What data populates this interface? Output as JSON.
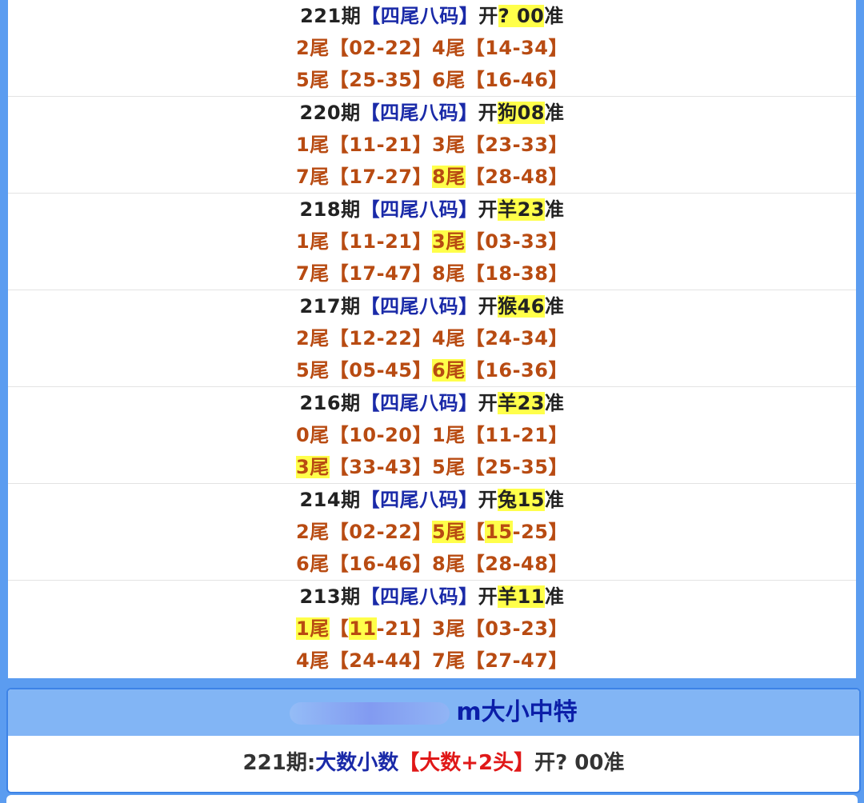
{
  "periods": [
    {
      "period": "221期",
      "tag": "【四尾八码】",
      "open_prefix": "开",
      "open_result": "? 00",
      "open_suffix": "准",
      "row1": [
        {
          "tail": "2尾",
          "nums": "【02-22】"
        },
        {
          "tail": "4尾",
          "nums": "【14-34】"
        }
      ],
      "row2": [
        {
          "tail": "5尾",
          "nums": "【25-35】"
        },
        {
          "tail": "6尾",
          "nums": "【16-46】"
        }
      ]
    },
    {
      "period": "220期",
      "tag": "【四尾八码】",
      "open_prefix": "开",
      "open_result": "狗08",
      "open_suffix": "准",
      "row1": [
        {
          "tail": "1尾",
          "nums": "【11-21】"
        },
        {
          "tail": "3尾",
          "nums": "【23-33】"
        }
      ],
      "row2": [
        {
          "tail": "7尾",
          "nums": "【17-27】"
        },
        {
          "tail": "8尾",
          "nums": "【28-48】"
        }
      ]
    },
    {
      "period": "218期",
      "tag": "【四尾八码】",
      "open_prefix": "开",
      "open_result": "羊23",
      "open_suffix": "准",
      "row1": [
        {
          "tail": "1尾",
          "nums": "【11-21】"
        },
        {
          "tail": "3尾",
          "nums": "【03-33】"
        }
      ],
      "row2": [
        {
          "tail": "7尾",
          "nums": "【17-47】"
        },
        {
          "tail": "8尾",
          "nums": "【18-38】"
        }
      ]
    },
    {
      "period": "217期",
      "tag": "【四尾八码】",
      "open_prefix": "开",
      "open_result": "猴46",
      "open_suffix": "准",
      "row1": [
        {
          "tail": "2尾",
          "nums": "【12-22】"
        },
        {
          "tail": "4尾",
          "nums": "【24-34】"
        }
      ],
      "row2": [
        {
          "tail": "5尾",
          "nums": "【05-45】"
        },
        {
          "tail": "6尾",
          "nums": "【16-36】"
        }
      ]
    },
    {
      "period": "216期",
      "tag": "【四尾八码】",
      "open_prefix": "开",
      "open_result": "羊23",
      "open_suffix": "准",
      "row1": [
        {
          "tail": "0尾",
          "nums": "【10-20】"
        },
        {
          "tail": "1尾",
          "nums": "【11-21】"
        }
      ],
      "row2": [
        {
          "tail": "3尾",
          "nums": "【33-43】"
        },
        {
          "tail": "5尾",
          "nums": "【25-35】"
        }
      ]
    },
    {
      "period": "214期",
      "tag": "【四尾八码】",
      "open_prefix": "开",
      "open_result": "兔15",
      "open_suffix": "准",
      "row1": [
        {
          "tail": "2尾",
          "nums": "【02-22】"
        },
        {
          "tail": "5尾",
          "nums_a": "【",
          "nums_hl": "15",
          "nums_b": "-25】"
        }
      ],
      "row2": [
        {
          "tail": "6尾",
          "nums": "【16-46】"
        },
        {
          "tail": "8尾",
          "nums": "【28-48】"
        }
      ]
    },
    {
      "period": "213期",
      "tag": "【四尾八码】",
      "open_prefix": "开",
      "open_result": "羊11",
      "open_suffix": "准",
      "row1": [
        {
          "tail": "1尾",
          "nums_a": "【",
          "nums_hl": "11",
          "nums_b": "-21】"
        },
        {
          "tail": "3尾",
          "nums": "【03-23】"
        }
      ],
      "row2": [
        {
          "tail": "4尾",
          "nums": "【24-44】"
        },
        {
          "tail": "7尾",
          "nums": "【27-47】"
        }
      ]
    }
  ],
  "section2": {
    "title": "m大小中特",
    "line": {
      "period": "221期:",
      "tag": "大数小数",
      "red": "【大数+2头】",
      "open": "开?",
      "result": " 00准"
    }
  },
  "colors": {
    "background_blue": "#5b9cf0",
    "title_bar": "#82b5f5",
    "tag_blue": "#1a2aa8",
    "tail_orange": "#b84b12",
    "highlight_yellow": "#ffff4a",
    "red": "#e01818"
  }
}
